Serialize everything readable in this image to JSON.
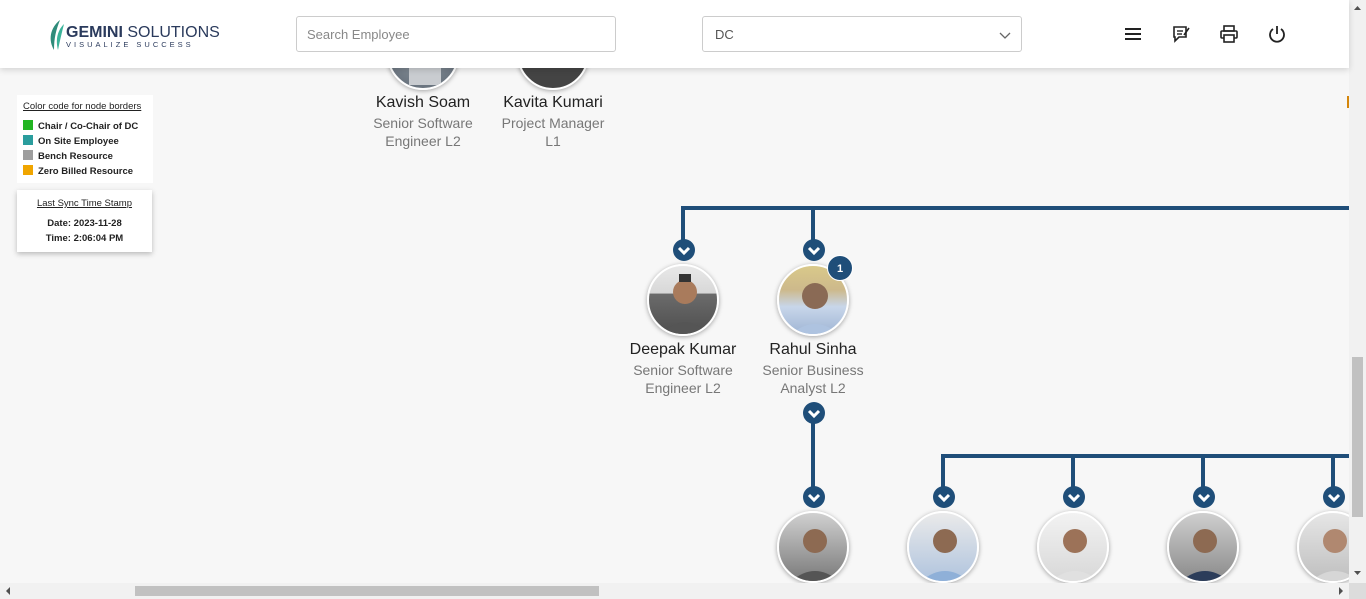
{
  "header": {
    "logo_name_bold": "GEMINI",
    "logo_name_light": " SOLUTIONS",
    "logo_tagline": "VISUALIZE SUCCESS",
    "search_placeholder": "Search Employee",
    "department_selected": "DC",
    "icons": [
      "menu-icon",
      "feedback-icon",
      "print-icon",
      "power-icon"
    ]
  },
  "legend": {
    "title": "Color code for node borders",
    "items": [
      {
        "label": "Chair / Co-Chair of DC",
        "color": "#22b522"
      },
      {
        "label": "On Site Employee",
        "color": "#2a9d9d"
      },
      {
        "label": "Bench Resource",
        "color": "#9e9e9e"
      },
      {
        "label": "Zero Billed Resource",
        "color": "#f0a500"
      }
    ]
  },
  "sync": {
    "title": "Last Sync Time Stamp",
    "date": "Date: 2023-11-28",
    "time": "Time: 2:06:04 PM"
  },
  "colors": {
    "connector": "#1f4e79",
    "accent_edge": "#d4860b"
  },
  "nodes_top": [
    {
      "name": "Kavish Soam",
      "title_l1": "Senior Software",
      "title_l2": "Engineer L2"
    },
    {
      "name": "Kavita Kumari",
      "title_l1": "Project Manager",
      "title_l2": "L1"
    }
  ],
  "nodes_mid": [
    {
      "name": "Deepak Kumar",
      "title_l1": "Senior Software",
      "title_l2": "Engineer L2"
    },
    {
      "name": "Rahul Sinha",
      "title_l1": "Senior Business",
      "title_l2": "Analyst L2",
      "badge": "1"
    }
  ]
}
